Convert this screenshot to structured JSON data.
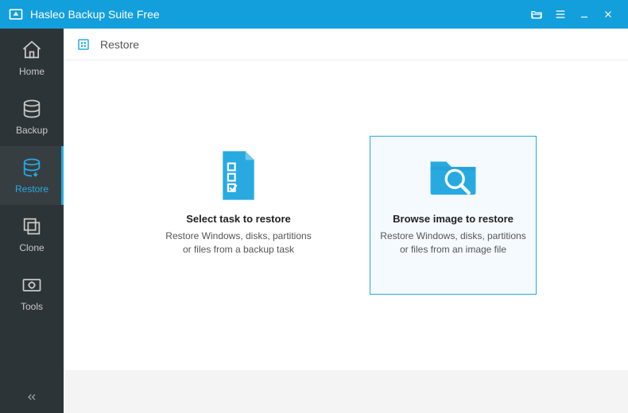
{
  "titlebar": {
    "app_name": "Hasleo Backup Suite Free"
  },
  "sidebar": {
    "items": [
      {
        "label": "Home"
      },
      {
        "label": "Backup"
      },
      {
        "label": "Restore"
      },
      {
        "label": "Clone"
      },
      {
        "label": "Tools"
      }
    ],
    "active_index": 2
  },
  "page": {
    "title": "Restore"
  },
  "cards": [
    {
      "title": "Select task to restore",
      "desc": "Restore Windows, disks, partitions or files from a backup task",
      "selected": false
    },
    {
      "title": "Browse image to restore",
      "desc": "Restore Windows, disks, partitions or files from an image file",
      "selected": true
    }
  ],
  "colors": {
    "accent": "#28aae1",
    "titlebar": "#139fdb",
    "sidebar": "#2d3438"
  }
}
